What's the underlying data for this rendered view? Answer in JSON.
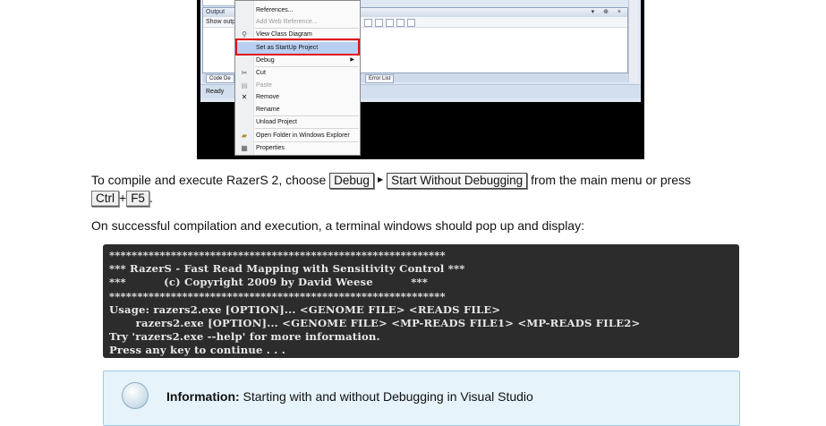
{
  "screenshot": {
    "output_title": "Output",
    "show_output_label": "Show outp",
    "tabs": [
      "Code De",
      "Error List"
    ],
    "status": "Ready",
    "context_menu": [
      {
        "label": "References...",
        "icon": "",
        "disabled": false,
        "highlight": false
      },
      {
        "label": "Add Web Reference...",
        "icon": "",
        "disabled": true,
        "highlight": false
      },
      {
        "label": "View Class Diagram",
        "icon": "class-diagram-icon",
        "disabled": false,
        "highlight": false
      },
      {
        "label": "Set as StartUp Project",
        "icon": "",
        "disabled": false,
        "highlight": true
      },
      {
        "label": "Debug",
        "icon": "",
        "disabled": false,
        "highlight": false,
        "submenu": true
      },
      {
        "label": "Cut",
        "icon": "scissors-icon",
        "disabled": false,
        "highlight": false
      },
      {
        "label": "Paste",
        "icon": "paste-icon",
        "disabled": true,
        "highlight": false
      },
      {
        "label": "Remove",
        "icon": "remove-x-icon",
        "disabled": false,
        "highlight": false
      },
      {
        "label": "Rename",
        "icon": "",
        "disabled": false,
        "highlight": false
      },
      {
        "label": "Unload Project",
        "icon": "",
        "disabled": false,
        "highlight": false
      },
      {
        "label": "Open Folder in Windows Explorer",
        "icon": "folder-icon",
        "disabled": false,
        "highlight": false
      },
      {
        "label": "Properties",
        "icon": "properties-icon",
        "disabled": false,
        "highlight": false
      }
    ]
  },
  "compile_text": {
    "prefix": "To compile and execute RazerS 2, choose",
    "menu_debug": "Debug",
    "menu_start": "Start Without Debugging",
    "middle": "from the main menu or press",
    "key_ctrl": "Ctrl",
    "plus": "+",
    "key_f5": "F5",
    "suffix": "."
  },
  "success_text": "On successful compilation and execution, a terminal windows should pop up and display:",
  "terminal_output": "************************************************************\n*** RazerS - Fast Read Mapping with Sensitivity Control ***\n***          (c) Copyright 2009 by David Weese          ***\n************************************************************\nUsage: razers2.exe [OPTION]... <GENOME FILE> <READS FILE>\n       razers2.exe [OPTION]... <GENOME FILE> <MP-READS FILE1> <MP-READS FILE2>\nTry 'razers2.exe --help' for more information.\nPress any key to continue . . .",
  "info": {
    "label": "Information:",
    "text": "Starting with and without Debugging in Visual Studio",
    "icon": "lightbulb-icon"
  }
}
